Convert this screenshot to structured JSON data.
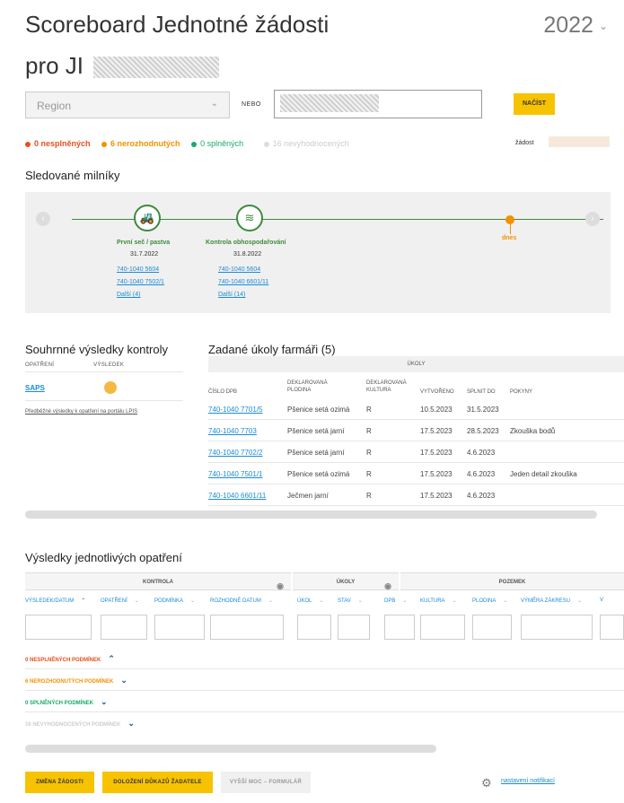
{
  "header": {
    "title_line1": "Scoreboard Jednotné žádosti",
    "title_line2": "pro JI",
    "year": "2022"
  },
  "search": {
    "region_placeholder": "Region",
    "or_label": "NEBO",
    "load_button": "NAČÍST"
  },
  "stats": {
    "unfulfilled": "0 nesplněných",
    "undecided": "6 nerozhodnutých",
    "fulfilled": "0 splněných",
    "unevaluated": "16 nevyhodnocených",
    "request_label": "žádost",
    "colors": {
      "red": "#e5501f",
      "orange": "#f39200",
      "green": "#1aaa6b",
      "grey": "#cccccc"
    }
  },
  "milestones": {
    "heading": "Sledované milníky",
    "items": [
      {
        "icon": "tractor-icon",
        "title": "První seč / pastva",
        "date": "31.7.2022",
        "links": [
          "740-1040 5604",
          "740-1040 7502/1"
        ],
        "more": "Další (4)"
      },
      {
        "icon": "field-icon",
        "title": "Kontrola obhospodařování",
        "date": "31.8.2022",
        "links": [
          "740-1040 5604",
          "740-1040 6601/11"
        ],
        "more": "Další (14)"
      }
    ],
    "today_label": "dnes"
  },
  "summary": {
    "heading": "Souhrnné výsledky kontroly",
    "col_measure": "OPATŘENÍ",
    "col_result": "VÝSLEDEK",
    "measure": "SAPS",
    "lpis_link": "Předběžné výsledky k opatření na portálu LPIS"
  },
  "tasks": {
    "heading": "Zadané úkoly farmáři (5)",
    "group_header": "ÚKOLY",
    "columns": [
      "ČÍSLO DPB",
      "DEKLAROVANÁ PLODINA",
      "DEKLAROVANÁ KULTURA",
      "VYTVOŘENO",
      "SPLNIT DO",
      "POKYNY"
    ],
    "rows": [
      [
        "740-1040 7701/5",
        "Pšenice setá ozimá",
        "R",
        "10.5.2023",
        "31.5.2023",
        ""
      ],
      [
        "740-1040 7703",
        "Pšenice setá jarní",
        "R",
        "17.5.2023",
        "28.5.2023",
        "Zkouška bodů"
      ],
      [
        "740-1040 7702/2",
        "Pšenice setá jarní",
        "R",
        "17.5.2023",
        "4.6.2023",
        ""
      ],
      [
        "740-1040 7501/1",
        "Pšenice setá ozimá",
        "R",
        "17.5.2023",
        "4.6.2023",
        "Jeden detail zkouška"
      ],
      [
        "740-1040 6601/11",
        "Ječmen jarní",
        "R",
        "17.5.2023",
        "4.6.2023",
        ""
      ]
    ]
  },
  "results": {
    "heading": "Výsledky jednotlivých opatření",
    "groups": {
      "control": "KONTROLA",
      "tasks": "ÚKOLY",
      "parcel": "POZEMEK"
    },
    "columns": {
      "result_date": "VÝSLEDEK/DATUM",
      "measure": "OPATŘENÍ",
      "condition": "PODMÍNKA",
      "decision_date": "ROZHODNÉ DATUM",
      "task": "ÚKOL",
      "state": "STAV",
      "dpb": "DPB",
      "culture": "KULTURA",
      "crop": "PLODINA",
      "area": "VÝMĚRA ZÁKRESU",
      "v": "V"
    },
    "group_rows": [
      {
        "label": "0 NESPLNĚNÝCH PODMÍNEK",
        "color": "#e5501f",
        "chev": "⌃"
      },
      {
        "label": "6 NEROZHODNUTÝCH PODMÍNEK",
        "color": "#f39200",
        "chev": "⌄"
      },
      {
        "label": "0 SPLNĚNÝCH PODMÍNEK",
        "color": "#1aaa6b",
        "chev": "⌄"
      },
      {
        "label": "16 NEVYHODNOCENÝCH PODMÍNEK",
        "color": "#cccccc",
        "chev": "⌄"
      }
    ]
  },
  "footer": {
    "change_request": "ZMĚNA ŽÁDOSTI",
    "submit_evidence": "DOLOŽENÍ DŮKAZŮ ŽADATELE",
    "force_majeure": "VYŠŠÍ MOC – FORMULÁŘ",
    "notifications": "nastavení notifikací"
  }
}
